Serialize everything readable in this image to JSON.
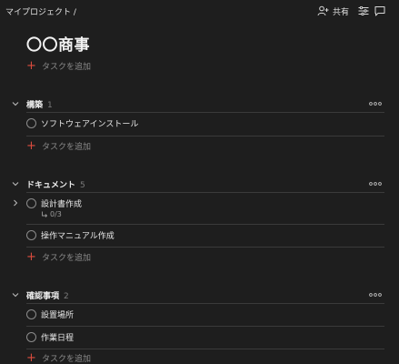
{
  "topbar": {
    "breadcrumb": "マイプロジェクト /",
    "share_label": "共有",
    "icons": [
      "add-person-icon",
      "view-options-icon",
      "comments-icon"
    ]
  },
  "project": {
    "title": "〇〇商事"
  },
  "add_task_label": "タスクを追加",
  "sections": [
    {
      "name": "構築",
      "count": "1",
      "tasks": [
        {
          "title": "ソフトウェアインストール"
        }
      ]
    },
    {
      "name": "ドキュメント",
      "count": "5",
      "tasks": [
        {
          "title": "設計書作成",
          "subtasks": "0/3"
        },
        {
          "title": "操作マニュアル作成"
        }
      ]
    },
    {
      "name": "確認事項",
      "count": "2",
      "tasks": [
        {
          "title": "設置場所"
        },
        {
          "title": "作業日程"
        }
      ]
    }
  ],
  "colors": {
    "background": "#1e1e1e",
    "accent": "#dc4c3e"
  }
}
